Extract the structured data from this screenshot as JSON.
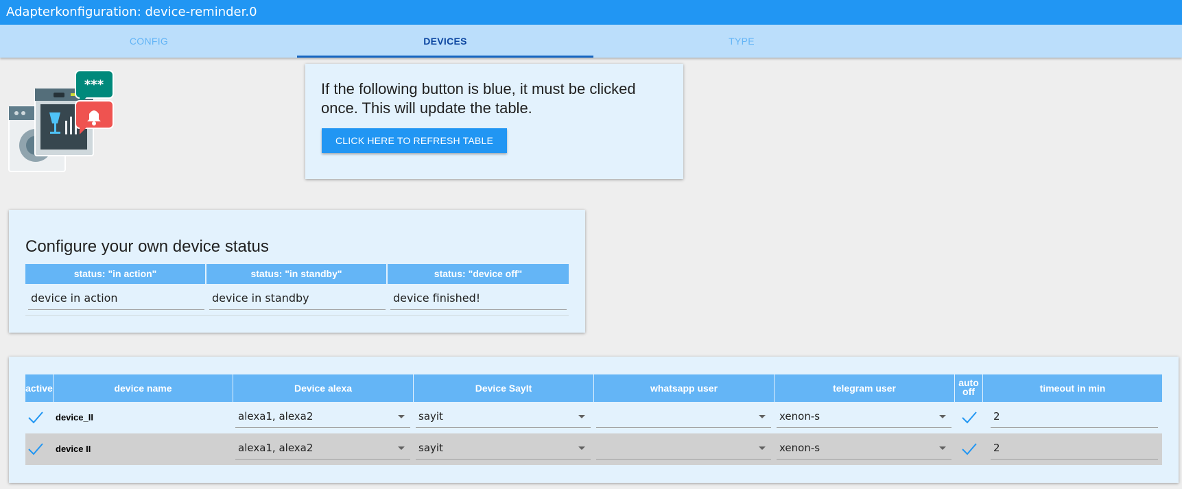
{
  "window": {
    "title": "Adapterkonfiguration: device-reminder.0"
  },
  "tabs": [
    {
      "label": "CONFIG",
      "active": false
    },
    {
      "label": "DEVICES",
      "active": true
    },
    {
      "label": "TYPE",
      "active": false
    }
  ],
  "refresh_card": {
    "text": "If the following button is blue, it must be clicked once. This will update the table.",
    "button_label": "CLICK HERE TO REFRESH TABLE"
  },
  "status_card": {
    "title": "Configure your own device status",
    "columns": [
      "status: \"in action\"",
      "status: \"in standby\"",
      "status: \"device off\""
    ],
    "values": [
      "device in action",
      "device in standby",
      "device finished!"
    ]
  },
  "devices_table": {
    "columns": {
      "active": "active",
      "device_name": "device name",
      "device_alexa": "Device alexa",
      "device_sayit": "Device SayIt",
      "whatsapp_user": "whatsapp user",
      "telegram_user": "telegram user",
      "auto_off": "auto\noff",
      "timeout": "timeout in min"
    },
    "rows": [
      {
        "active": true,
        "device_name": "device_II",
        "device_alexa": "alexa1, alexa2",
        "device_sayit": "sayit",
        "whatsapp_user": "",
        "telegram_user": "xenon-s",
        "auto_off": true,
        "timeout": "2"
      },
      {
        "active": true,
        "device_name": "device II",
        "device_alexa": "alexa1, alexa2",
        "device_sayit": "sayit",
        "whatsapp_user": "",
        "telegram_user": "xenon-s",
        "auto_off": true,
        "timeout": "2"
      }
    ]
  },
  "colors": {
    "primary": "#2196f3",
    "tab_bar": "#bbdefb",
    "card_bg": "#e3f2fd",
    "table_header": "#64b5f6",
    "check": "#2196f3"
  },
  "icons": {
    "logo": "device-reminder-logo",
    "check": "check-icon",
    "dropdown": "chevron-down-icon"
  }
}
